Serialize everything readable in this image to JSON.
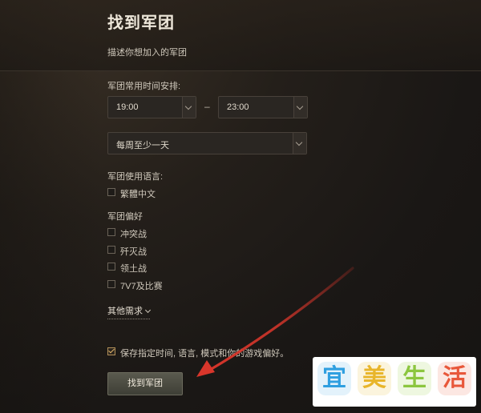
{
  "page": {
    "title": "找到军团",
    "subtitle": "描述你想加入的军团"
  },
  "schedule": {
    "label": "军团常用时间安排:",
    "start_time": "19:00",
    "separator": "–",
    "end_time": "23:00",
    "frequency": "每周至少一天"
  },
  "language": {
    "label": "军团使用语言:",
    "options": [
      {
        "label": "繁體中文",
        "checked": false
      }
    ]
  },
  "preferences": {
    "label": "军团偏好",
    "options": [
      {
        "label": "冲突战",
        "checked": false
      },
      {
        "label": "歼灭战",
        "checked": false
      },
      {
        "label": "领土战",
        "checked": false
      },
      {
        "label": "7V7及比赛",
        "checked": false
      }
    ]
  },
  "more_requirements": {
    "label": "其他需求"
  },
  "save": {
    "label": "保存指定时间, 语言, 模式和你的游戏偏好。",
    "checked": true
  },
  "submit": {
    "label": "找到军团"
  },
  "watermark": {
    "chars": [
      "宜",
      "美",
      "生",
      "活"
    ],
    "colors": [
      "#2f9fe0",
      "#e8b52a",
      "#8cc63f",
      "#e8573a"
    ]
  },
  "colors": {
    "accent_arrow": "#d9362b",
    "button_bg": "#4e4e44"
  },
  "icons": {
    "dropdown": "chevron-down-icon",
    "annotation": "red-arrow-icon"
  }
}
